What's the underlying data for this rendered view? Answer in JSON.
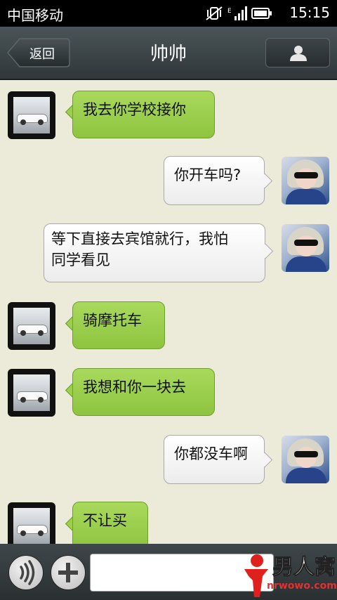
{
  "status_bar": {
    "carrier": "中国移动",
    "time": "15:15",
    "network": "E"
  },
  "header": {
    "back_label": "返回",
    "title": "帅帅",
    "profile_icon": "person-icon"
  },
  "messages": [
    {
      "from": "contact",
      "avatar": "car-avatar",
      "text": "我去你学校接你"
    },
    {
      "from": "me",
      "avatar": "girl-avatar",
      "text": "你开车吗?"
    },
    {
      "from": "me",
      "avatar": "girl-avatar",
      "lines": [
        "等下直接去宾馆就行，我怕",
        "同学看见"
      ]
    },
    {
      "from": "contact",
      "avatar": "car-avatar",
      "text": "骑摩托车"
    },
    {
      "from": "contact",
      "avatar": "car-avatar",
      "text": "我想和你一块去"
    },
    {
      "from": "me",
      "avatar": "girl-avatar",
      "text": "你都没车啊"
    },
    {
      "from": "contact",
      "avatar": "car-avatar",
      "text": "不让买"
    }
  ],
  "input_bar": {
    "voice_icon": "voice-icon",
    "plus_icon": "plus-icon",
    "text_value": ""
  },
  "watermark": {
    "brand": "男人窝",
    "url": "nrwowo.com"
  },
  "colors": {
    "incoming_bubble": "#9ccf4e",
    "outgoing_bubble": "#f5f5f5",
    "background": "#ecebd9",
    "header": "#3a4245"
  }
}
